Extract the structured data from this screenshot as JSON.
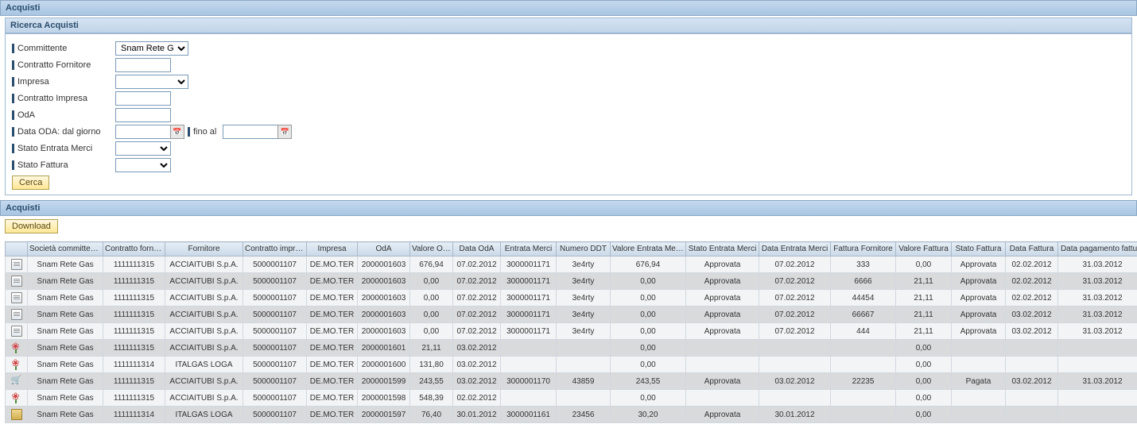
{
  "header": {
    "title": "Acquisti"
  },
  "search": {
    "title": "Ricerca Acquisti",
    "fields": {
      "committente_label": "Committente",
      "committente_value": "Snam Rete Gas",
      "contratto_fornitore_label": "Contratto Fornitore",
      "impresa_label": "Impresa",
      "contratto_impresa_label": "Contratto Impresa",
      "oda_label": "OdA",
      "data_oda_label": "Data ODA: dal giorno",
      "fino_al_label": "fino al",
      "stato_entrata_merci_label": "Stato Entrata Merci",
      "stato_fattura_label": "Stato Fattura"
    },
    "search_button": "Cerca"
  },
  "results": {
    "title": "Acquisti",
    "download_button": "Download",
    "columns": [
      "",
      "Società committente",
      "Contratto fornitore",
      "Fornitore",
      "Contratto impresa",
      "Impresa",
      "OdA",
      "Valore OdA",
      "Data OdA",
      "Entrata Merci",
      "Numero DDT",
      "Valore Entrata Merci",
      "Stato Entrata Merci",
      "Data Entrata Merci",
      "Fattura Fornitore",
      "Valore Fattura",
      "Stato Fattura",
      "Data Fattura",
      "Data pagamento fattura"
    ],
    "rows": [
      {
        "icon": "doc",
        "cells": [
          "Snam Rete Gas",
          "1111111315",
          "ACCIAITUBI S.p.A.",
          "5000001107",
          "DE.MO.TER",
          "2000001603",
          "676,94",
          "07.02.2012",
          "3000001171",
          "3e4rty",
          "676,94",
          "Approvata",
          "07.02.2012",
          "333",
          "0,00",
          "Approvata",
          "02.02.2012",
          "31.03.2012"
        ]
      },
      {
        "icon": "doc",
        "cells": [
          "Snam Rete Gas",
          "1111111315",
          "ACCIAITUBI S.p.A.",
          "5000001107",
          "DE.MO.TER",
          "2000001603",
          "0,00",
          "07.02.2012",
          "3000001171",
          "3e4rty",
          "0,00",
          "Approvata",
          "07.02.2012",
          "6666",
          "21,11",
          "Approvata",
          "02.02.2012",
          "31.03.2012"
        ]
      },
      {
        "icon": "doc",
        "cells": [
          "Snam Rete Gas",
          "1111111315",
          "ACCIAITUBI S.p.A.",
          "5000001107",
          "DE.MO.TER",
          "2000001603",
          "0,00",
          "07.02.2012",
          "3000001171",
          "3e4rty",
          "0,00",
          "Approvata",
          "07.02.2012",
          "44454",
          "21,11",
          "Approvata",
          "02.02.2012",
          "31.03.2012"
        ]
      },
      {
        "icon": "doc",
        "cells": [
          "Snam Rete Gas",
          "1111111315",
          "ACCIAITUBI S.p.A.",
          "5000001107",
          "DE.MO.TER",
          "2000001603",
          "0,00",
          "07.02.2012",
          "3000001171",
          "3e4rty",
          "0,00",
          "Approvata",
          "07.02.2012",
          "66667",
          "21,11",
          "Approvata",
          "03.02.2012",
          "31.03.2012"
        ]
      },
      {
        "icon": "doc",
        "cells": [
          "Snam Rete Gas",
          "1111111315",
          "ACCIAITUBI S.p.A.",
          "5000001107",
          "DE.MO.TER",
          "2000001603",
          "0,00",
          "07.02.2012",
          "3000001171",
          "3e4rty",
          "0,00",
          "Approvata",
          "07.02.2012",
          "444",
          "21,11",
          "Approvata",
          "03.02.2012",
          "31.03.2012"
        ]
      },
      {
        "icon": "flower",
        "cells": [
          "Snam Rete Gas",
          "1111111315",
          "ACCIAITUBI S.p.A.",
          "5000001107",
          "DE.MO.TER",
          "2000001601",
          "21,11",
          "03.02.2012",
          "",
          "",
          "0,00",
          "",
          "",
          "",
          "0,00",
          "",
          "",
          ""
        ]
      },
      {
        "icon": "flower",
        "cells": [
          "Snam Rete Gas",
          "1111111314",
          "ITALGAS LOGA",
          "5000001107",
          "DE.MO.TER",
          "2000001600",
          "131,80",
          "03.02.2012",
          "",
          "",
          "0,00",
          "",
          "",
          "",
          "0,00",
          "",
          "",
          ""
        ]
      },
      {
        "icon": "cart",
        "cells": [
          "Snam Rete Gas",
          "1111111315",
          "ACCIAITUBI S.p.A.",
          "5000001107",
          "DE.MO.TER",
          "2000001599",
          "243,55",
          "03.02.2012",
          "3000001170",
          "43859",
          "243,55",
          "Approvata",
          "03.02.2012",
          "22235",
          "0,00",
          "Pagata",
          "03.02.2012",
          "31.03.2012"
        ]
      },
      {
        "icon": "flower",
        "cells": [
          "Snam Rete Gas",
          "1111111315",
          "ACCIAITUBI S.p.A.",
          "5000001107",
          "DE.MO.TER",
          "2000001598",
          "548,39",
          "02.02.2012",
          "",
          "",
          "0,00",
          "",
          "",
          "",
          "0,00",
          "",
          "",
          ""
        ]
      },
      {
        "icon": "box",
        "cells": [
          "Snam Rete Gas",
          "1111111314",
          "ITALGAS LOGA",
          "5000001107",
          "DE.MO.TER",
          "2000001597",
          "76,40",
          "30.01.2012",
          "3000001161",
          "23456",
          "30,20",
          "Approvata",
          "30.01.2012",
          "",
          "0,00",
          "",
          "",
          ""
        ]
      }
    ]
  }
}
